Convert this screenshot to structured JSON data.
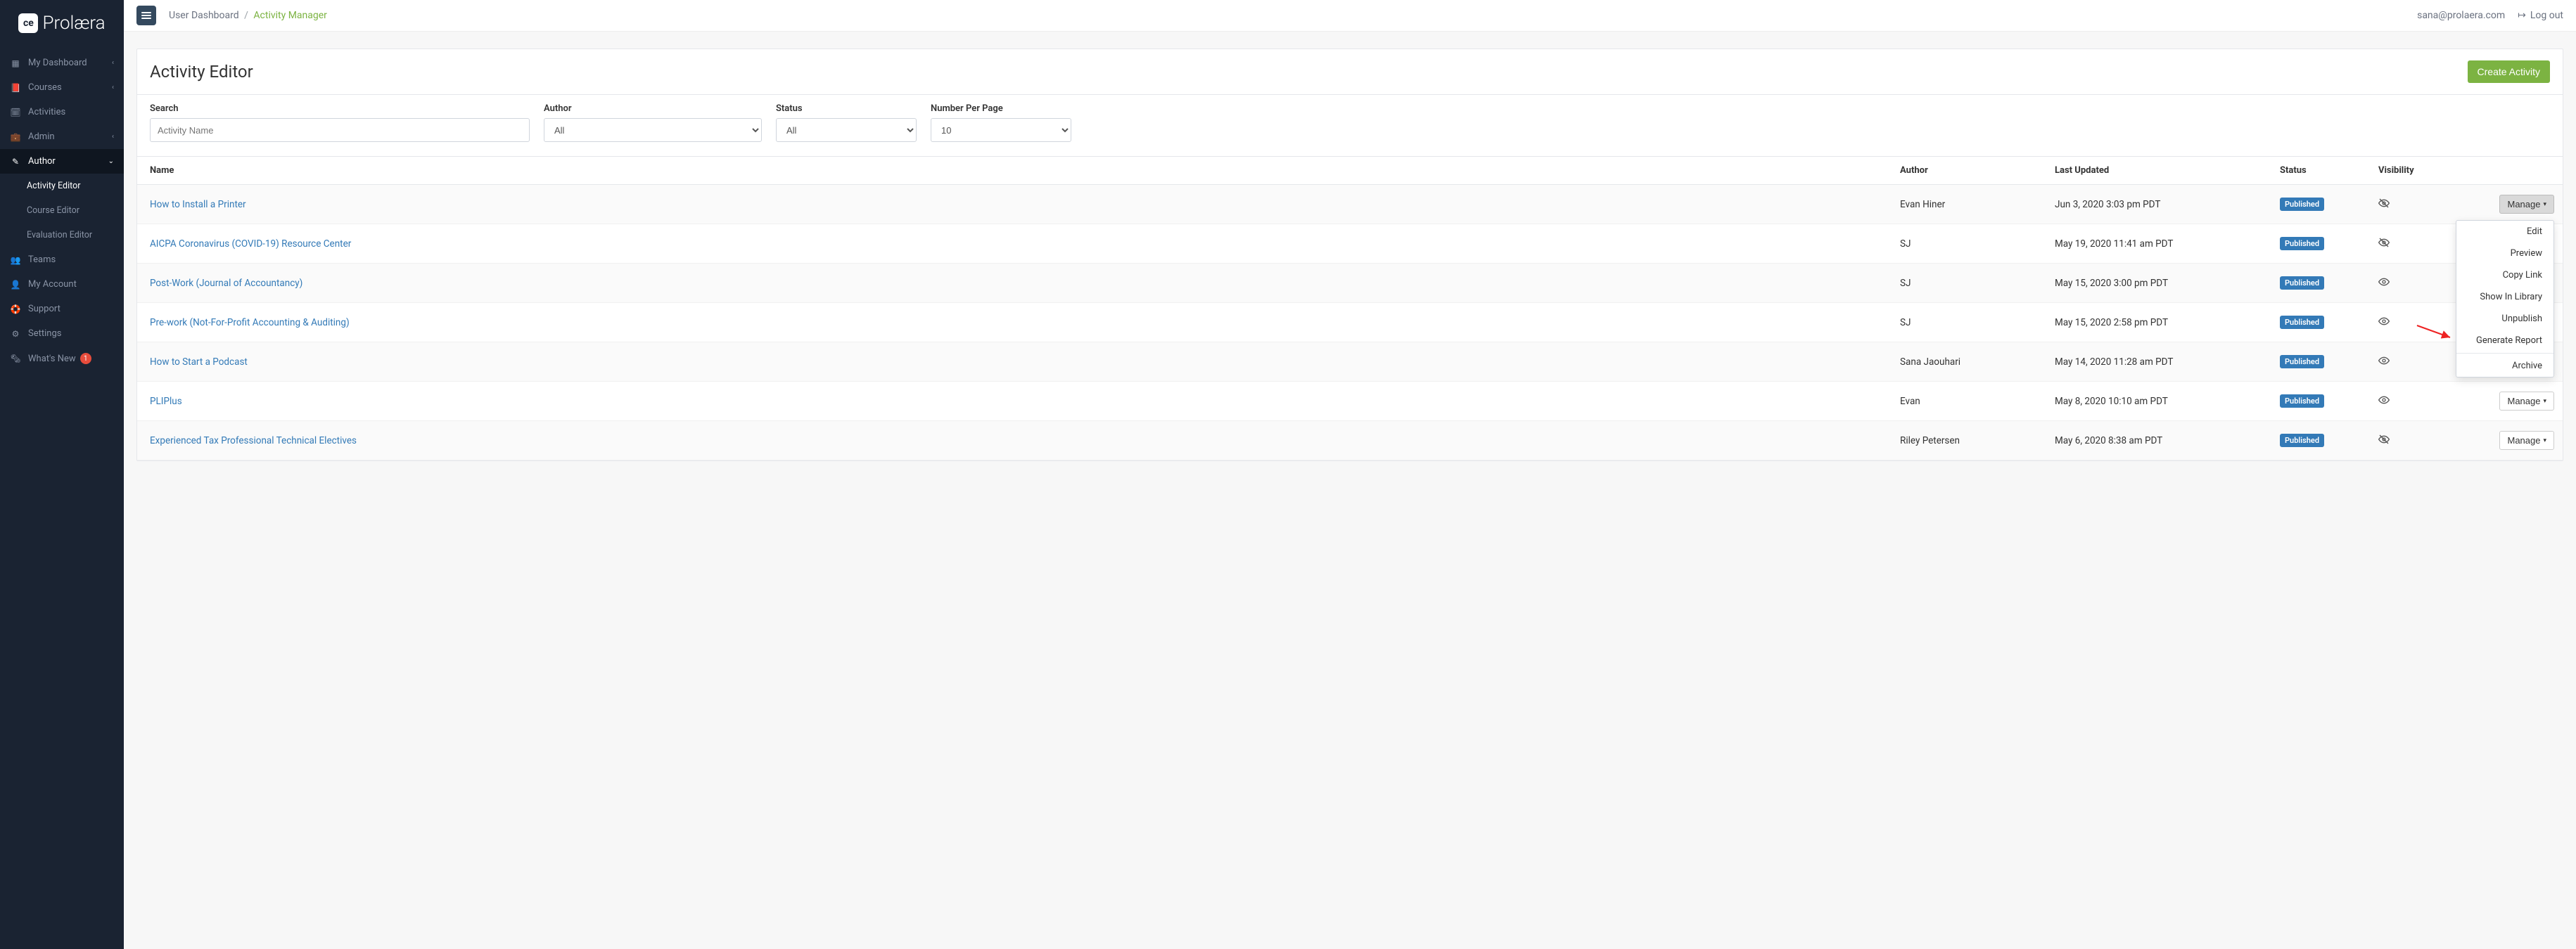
{
  "brand": {
    "name": "Prolæra",
    "badge": "ce"
  },
  "breadcrumb": {
    "root": "User Dashboard",
    "current": "Activity Manager"
  },
  "user": {
    "email": "sana@prolaera.com",
    "logout_label": "Log out"
  },
  "sidebar": {
    "items": [
      {
        "label": "My Dashboard",
        "icon": "grid-icon",
        "has_children": true
      },
      {
        "label": "Courses",
        "icon": "book-icon",
        "has_children": true
      },
      {
        "label": "Activities",
        "icon": "calendar-icon",
        "has_children": false
      },
      {
        "label": "Admin",
        "icon": "briefcase-icon",
        "has_children": true
      },
      {
        "label": "Author",
        "icon": "edit-icon",
        "has_children": true,
        "expanded": true,
        "children": [
          {
            "label": "Activity Editor",
            "current": true
          },
          {
            "label": "Course Editor"
          },
          {
            "label": "Evaluation Editor"
          }
        ]
      },
      {
        "label": "Teams",
        "icon": "users-icon",
        "has_children": false
      },
      {
        "label": "My Account",
        "icon": "user-icon",
        "has_children": false
      },
      {
        "label": "Support",
        "icon": "lifebuoy-icon",
        "has_children": false
      },
      {
        "label": "Settings",
        "icon": "gear-icon",
        "has_children": false
      },
      {
        "label": "What's New",
        "icon": "news-icon",
        "has_children": false,
        "badge": "1"
      }
    ]
  },
  "page": {
    "title": "Activity Editor",
    "create_label": "Create Activity"
  },
  "filters": {
    "search_label": "Search",
    "search_placeholder": "Activity Name",
    "author_label": "Author",
    "author_value": "All",
    "status_label": "Status",
    "status_value": "All",
    "perpage_label": "Number Per Page",
    "perpage_value": "10"
  },
  "table": {
    "columns": [
      "Name",
      "Author",
      "Last Updated",
      "Status",
      "Visibility"
    ],
    "manage_label": "Manage",
    "rows": [
      {
        "name": "How to Install a Printer",
        "author": "Evan Hiner",
        "updated": "Jun 3, 2020 3:03 pm PDT",
        "status": "Published",
        "visibility": "hidden",
        "menu_open": true
      },
      {
        "name": "AICPA Coronavirus (COVID-19) Resource Center",
        "author": "SJ",
        "updated": "May 19, 2020 11:41 am PDT",
        "status": "Published",
        "visibility": "hidden"
      },
      {
        "name": "Post-Work (Journal of Accountancy)",
        "author": "SJ",
        "updated": "May 15, 2020 3:00 pm PDT",
        "status": "Published",
        "visibility": "visible"
      },
      {
        "name": "Pre-work (Not-For-Profit Accounting & Auditing)",
        "author": "SJ",
        "updated": "May 15, 2020 2:58 pm PDT",
        "status": "Published",
        "visibility": "visible"
      },
      {
        "name": "How to Start a Podcast",
        "author": "Sana Jaouhari",
        "updated": "May 14, 2020 11:28 am PDT",
        "status": "Published",
        "visibility": "visible"
      },
      {
        "name": "PLIPlus",
        "author": "Evan",
        "updated": "May 8, 2020 10:10 am PDT",
        "status": "Published",
        "visibility": "visible"
      },
      {
        "name": "Experienced Tax Professional Technical Electives",
        "author": "Riley Petersen",
        "updated": "May 6, 2020 8:38 am PDT",
        "status": "Published",
        "visibility": "hidden"
      }
    ]
  },
  "manage_menu": {
    "items": [
      "Edit",
      "Preview",
      "Copy Link",
      "Show In Library",
      "Unpublish",
      "Generate Report"
    ],
    "archive": "Archive"
  }
}
